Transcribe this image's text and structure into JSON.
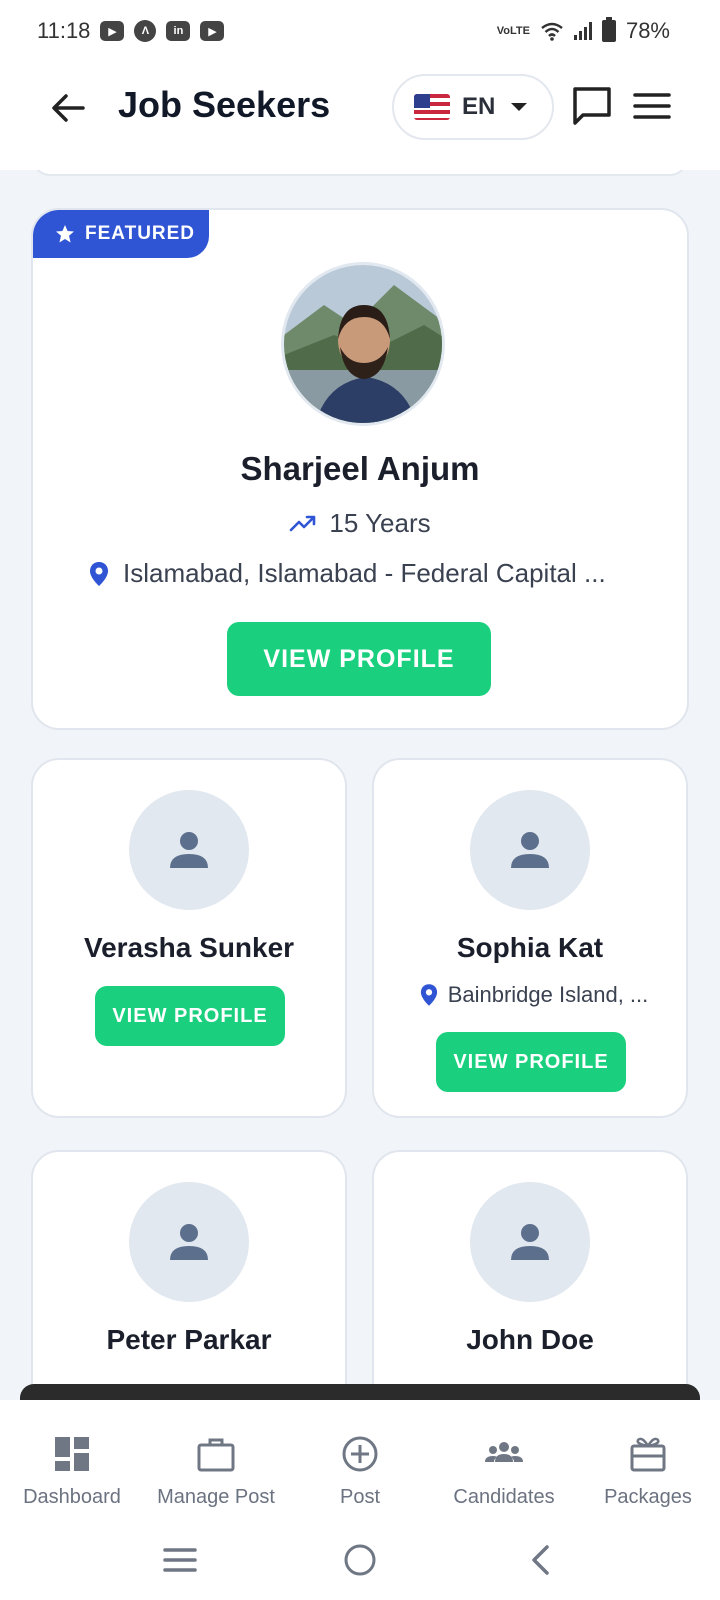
{
  "status_bar": {
    "time": "11:18",
    "notifications": [
      "youtube-icon",
      "app-icon",
      "linkedin-icon",
      "youtube-icon"
    ],
    "network": "VoLTE",
    "battery": "78%"
  },
  "header": {
    "title": "Job Seekers",
    "language": "EN"
  },
  "featured": {
    "badge": "FEATURED",
    "name": "Sharjeel Anjum",
    "experience": "15 Years",
    "location": "Islamabad, Islamabad - Federal Capital ...",
    "button": "VIEW PROFILE"
  },
  "candidates": [
    {
      "name": "Verasha Sunker",
      "location": "",
      "button": "VIEW PROFILE"
    },
    {
      "name": "Sophia Kat",
      "location": "Bainbridge Island, ...",
      "button": "VIEW PROFILE"
    },
    {
      "name": "Peter Parkar"
    },
    {
      "name": "John Doe"
    }
  ],
  "bottom_nav": {
    "items": [
      {
        "label": "Dashboard",
        "icon": "dashboard-icon"
      },
      {
        "label": "Manage Post",
        "icon": "briefcase-icon"
      },
      {
        "label": "Post",
        "icon": "plus-circle-icon"
      },
      {
        "label": "Candidates",
        "icon": "group-icon"
      },
      {
        "label": "Packages",
        "icon": "gift-icon"
      }
    ]
  },
  "colors": {
    "accent_green": "#1ad07e",
    "badge_blue": "#2f54d4",
    "pin_blue": "#2f54d4",
    "background": "#f1f4f8"
  }
}
